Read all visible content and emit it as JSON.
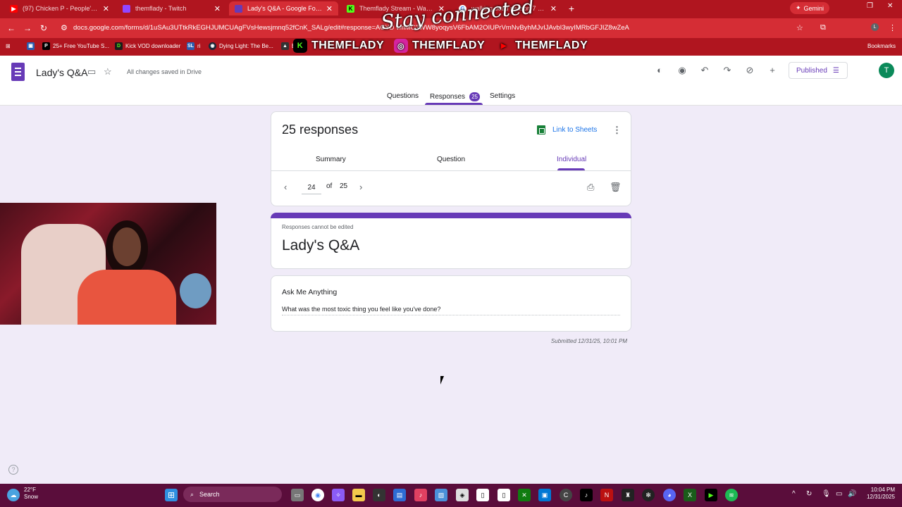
{
  "browser": {
    "tabs": [
      {
        "title": "(97) Chicken P - People's Favor",
        "icon": "youtube-icon",
        "color": "#ff0000",
        "active": false
      },
      {
        "title": "themflady - Twitch",
        "icon": "twitch-icon",
        "color": "#9146ff",
        "active": false
      },
      {
        "title": "Lady's Q&A - Google Forms",
        "icon": "forms-icon",
        "color": "#673ab7",
        "active": true
      },
      {
        "title": "Themflady Stream - Watch Live",
        "icon": "kick-icon",
        "color": "#53fc18",
        "active": false
      },
      {
        "title": "walking dead season 7 episode",
        "icon": "google-icon",
        "color": "#ffffff",
        "active": false
      }
    ],
    "gemini_label": "Gemini",
    "url": "docs.google.com/forms/d/1uSAu3UTtkRkEGHJUMCUAgFVsHewsjmnq52fCnK_SALg/edit#response=ACYD",
    "url_tail": "vmM",
    "url_tail2": "C3WW8yoqysV6FbA",
    "url_tail3": "M2",
    "url_tail4": "OIUPrVmNvByhMJvIJAvbI3wyIMRbGFJIZ8wZeA",
    "bookmarks": [
      {
        "label": "25+ Free YouTube S...",
        "icon": "p-icon",
        "color": "#000000"
      },
      {
        "label": "Kick VOD downloader",
        "icon": "d-icon",
        "color": "#1b1b1b"
      },
      {
        "label": "ri",
        "icon": "sl-icon",
        "color": "#2a5db0"
      },
      {
        "label": "Dying Light: The Be...",
        "icon": "steam-icon",
        "color": "#1b2838"
      },
      {
        "label": "En",
        "icon": "bookmark-icon",
        "color": "#333333"
      }
    ],
    "bookmarks_all": "Bookmarks",
    "overlay_text": "Stay connected",
    "brand_items": [
      {
        "label": "THEMFLADY",
        "icon": "kick-logo-icon",
        "color": "#53fc18"
      },
      {
        "label": "THEMFLADY",
        "icon": "instagram-icon",
        "color": "#d6249f"
      },
      {
        "label": "THEMFLADY",
        "icon": "youtube-icon",
        "color": "#ff0000"
      }
    ]
  },
  "forms_header": {
    "title": "Lady's Q&A",
    "saved_status": "All changes saved in Drive",
    "publish_label": "Published",
    "avatar_initial": "T",
    "tabs": [
      {
        "label": "Questions"
      },
      {
        "label": "Responses",
        "badge": "25"
      },
      {
        "label": "Settings"
      }
    ]
  },
  "responses": {
    "count_label": "25 responses",
    "link_sheets": "Link to Sheets",
    "subtabs": [
      "Summary",
      "Question",
      "Individual"
    ],
    "pager": {
      "current": "24",
      "of": "of",
      "total": "25"
    }
  },
  "response_card": {
    "note": "Responses cannot be edited",
    "form_title": "Lady's Q&A",
    "question": "Ask Me Anything",
    "answer": "What was the most toxic thing you feel like you've done?",
    "submitted": "Submitted 12/31/25, 10:01 PM"
  },
  "taskbar": {
    "weather_temp": "22°F",
    "weather_cond": "Snow",
    "search_label": "Search",
    "time": "10:04 PM",
    "date": "12/31/2025"
  }
}
